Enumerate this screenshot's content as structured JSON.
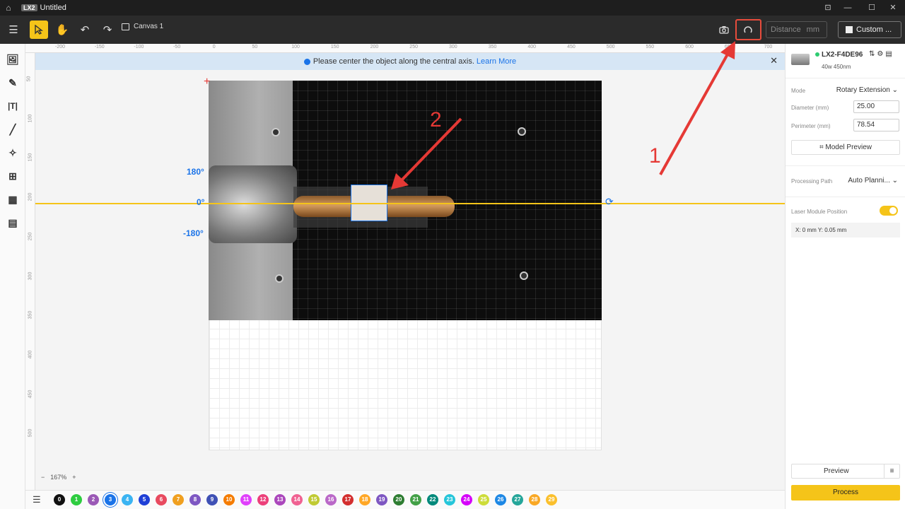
{
  "titlebar": {
    "app_badge": "LX2",
    "title": "Untitled"
  },
  "toolbar": {
    "canvas_label": "Canvas 1",
    "distance_placeholder": "Distance",
    "distance_unit": "mm",
    "custom_label": "Custom ..."
  },
  "rulers": {
    "top_ticks": [
      "-200",
      "-150",
      "-100",
      "-50",
      "0",
      "50",
      "100",
      "150",
      "200",
      "250",
      "300",
      "350",
      "400",
      "450",
      "500",
      "550",
      "600",
      "650",
      "700"
    ],
    "left_ticks": [
      "50",
      "100",
      "150",
      "200",
      "250",
      "300",
      "350",
      "400",
      "450",
      "500"
    ]
  },
  "info": {
    "message": "Please center the object along the central axis.",
    "link": "Learn More"
  },
  "canvas": {
    "deg_top": "180°",
    "deg_mid": "0°",
    "deg_bottom": "-180°",
    "annotation_1": "1",
    "annotation_2": "2"
  },
  "zoom": {
    "minus": "−",
    "level": "167%",
    "plus": "+"
  },
  "layers": [
    {
      "n": "0",
      "color": "#111111"
    },
    {
      "n": "1",
      "color": "#2ecc40"
    },
    {
      "n": "2",
      "color": "#9b59b6"
    },
    {
      "n": "3",
      "color": "#1a73e8"
    },
    {
      "n": "4",
      "color": "#3bb4f2"
    },
    {
      "n": "5",
      "color": "#1f3fd6"
    },
    {
      "n": "6",
      "color": "#e84a5f"
    },
    {
      "n": "7",
      "color": "#f0a020"
    },
    {
      "n": "8",
      "color": "#7e57c2"
    },
    {
      "n": "9",
      "color": "#3f51b5"
    },
    {
      "n": "10",
      "color": "#f57c00"
    },
    {
      "n": "11",
      "color": "#e040fb"
    },
    {
      "n": "12",
      "color": "#ec407a"
    },
    {
      "n": "13",
      "color": "#ab47bc"
    },
    {
      "n": "14",
      "color": "#f06292"
    },
    {
      "n": "15",
      "color": "#c0ca33"
    },
    {
      "n": "16",
      "color": "#ba68c8"
    },
    {
      "n": "17",
      "color": "#d32f2f"
    },
    {
      "n": "18",
      "color": "#ffa726"
    },
    {
      "n": "19",
      "color": "#7e57c2"
    },
    {
      "n": "20",
      "color": "#2e7d32"
    },
    {
      "n": "21",
      "color": "#43a047"
    },
    {
      "n": "22",
      "color": "#00897b"
    },
    {
      "n": "23",
      "color": "#26c6da"
    },
    {
      "n": "24",
      "color": "#d500f9"
    },
    {
      "n": "25",
      "color": "#cddc39"
    },
    {
      "n": "26",
      "color": "#1e88e5"
    },
    {
      "n": "27",
      "color": "#26a69a"
    },
    {
      "n": "28",
      "color": "#f9a825"
    },
    {
      "n": "29",
      "color": "#fbc02d"
    }
  ],
  "device": {
    "name": "LX2-F4DE96",
    "sub": "40w 450nm",
    "status_color": "#2ecc71"
  },
  "panel": {
    "mode_label": "Mode",
    "mode_value": "Rotary Extension ⌄",
    "diameter_label": "Diameter  (mm)",
    "diameter_value": "25.00",
    "perimeter_label": "Perimeter  (mm)",
    "perimeter_value": "78.54",
    "model_preview": "Model Preview",
    "path_label": "Processing Path",
    "path_value": "Auto Planni... ⌄",
    "laser_label": "Laser Module Position",
    "position": "X: 0 mm   Y: 0.05 mm",
    "preview": "Preview",
    "process": "Process"
  },
  "colors": {
    "accent": "#f5c419",
    "link": "#1a73e8",
    "annotation": "#e53935"
  }
}
